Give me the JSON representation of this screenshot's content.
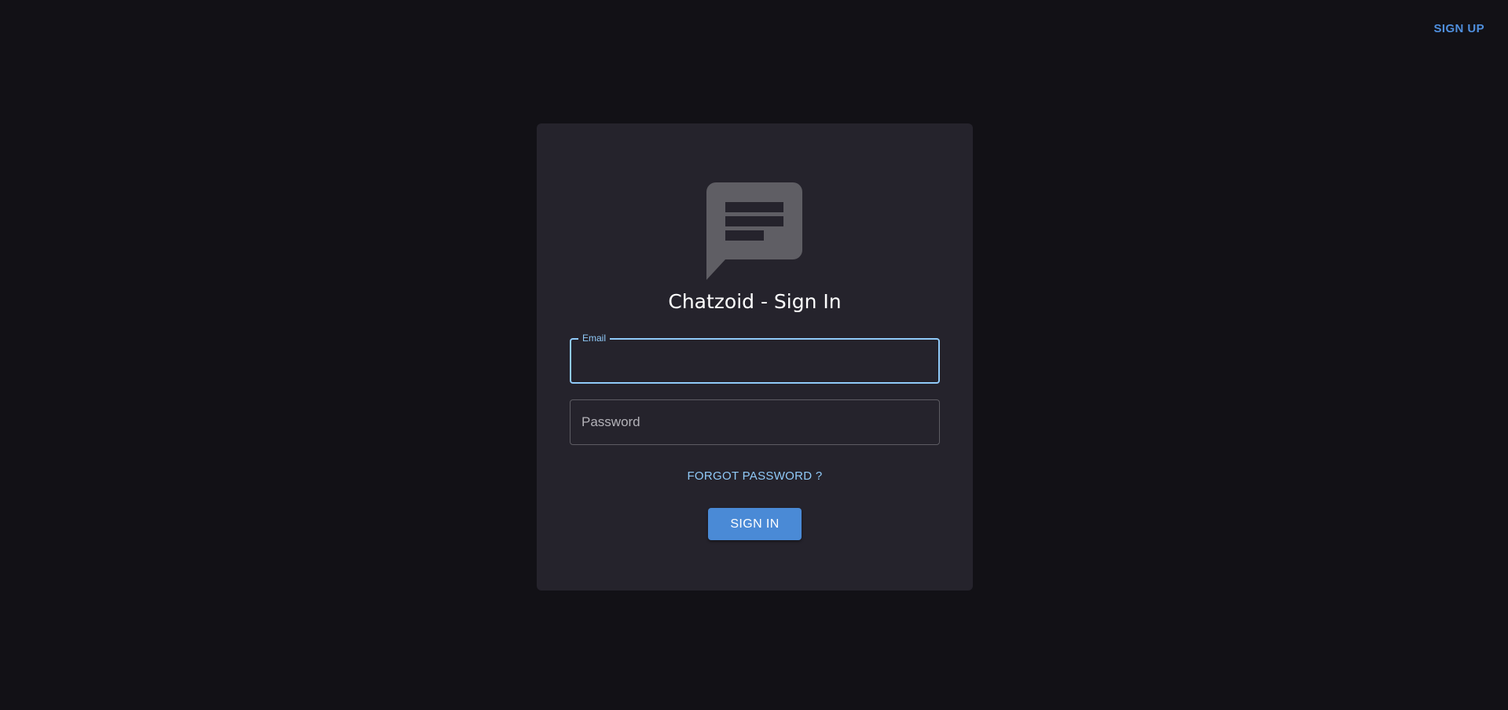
{
  "header": {
    "signup_label": "SIGN UP"
  },
  "card": {
    "logo_icon": "chat-message-icon",
    "title": "Chatzoid - Sign In",
    "email": {
      "label": "Email",
      "value": ""
    },
    "password": {
      "placeholder": "Password",
      "value": ""
    },
    "forgot_label": "FORGOT PASSWORD ?",
    "signin_label": "SIGN IN"
  },
  "colors": {
    "background": "#121116",
    "card": "#25232c",
    "accent": "#90caf9",
    "primary_button": "#4a8ad6",
    "link": "#4f8fde"
  }
}
